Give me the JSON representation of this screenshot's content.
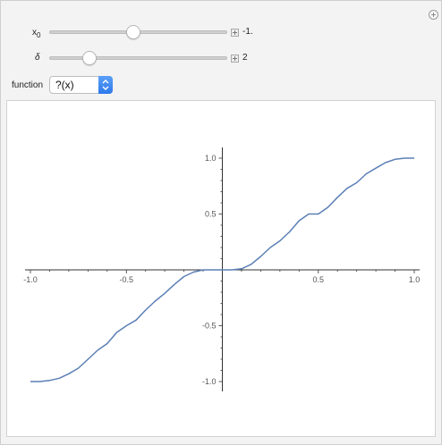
{
  "controls": {
    "x0": {
      "label_main": "x",
      "label_sub": "0",
      "value_text": "-1.",
      "level": 0.47
    },
    "delta": {
      "label": "δ",
      "value_text": "2",
      "level": 0.2
    },
    "function": {
      "label": "function",
      "selected": "?(x)"
    }
  },
  "colors": {
    "curve": "#5b7fb5",
    "axis": "#333333",
    "popup_accent": "#3b82f0"
  },
  "chart_data": {
    "type": "line",
    "xlim": [
      -1.0,
      1.0
    ],
    "ylim": [
      -1.0,
      1.0
    ],
    "x_ticks": [
      "-1.0",
      "-0.5",
      "0.5",
      "1.0"
    ],
    "y_ticks": [
      "1.0",
      "0.5",
      "-0.5",
      "-1.0"
    ],
    "series": [
      {
        "x": [
          -1.0,
          -0.95,
          -0.9,
          -0.85,
          -0.8,
          -0.75,
          -0.7,
          -0.65,
          -0.6,
          -0.55,
          -0.5,
          -0.45,
          -0.4,
          -0.35,
          -0.3,
          -0.25,
          -0.2,
          -0.15,
          -0.1,
          -0.05,
          0.0,
          0.05,
          0.1,
          0.15,
          0.2,
          0.25,
          0.3,
          0.35,
          0.4,
          0.45,
          0.5,
          0.55,
          0.6,
          0.65,
          0.7,
          0.75,
          0.8,
          0.85,
          0.9,
          0.95,
          1.0
        ],
        "y": [
          -1.0,
          -1.0,
          -0.99,
          -0.97,
          -0.93,
          -0.88,
          -0.8,
          -0.72,
          -0.66,
          -0.56,
          -0.5,
          -0.45,
          -0.36,
          -0.28,
          -0.21,
          -0.13,
          -0.06,
          -0.02,
          0.0,
          0.0,
          0.0,
          0.0,
          0.01,
          0.05,
          0.12,
          0.2,
          0.26,
          0.34,
          0.44,
          0.5,
          0.5,
          0.56,
          0.65,
          0.73,
          0.78,
          0.86,
          0.91,
          0.96,
          0.99,
          1.0,
          1.0
        ]
      }
    ]
  }
}
